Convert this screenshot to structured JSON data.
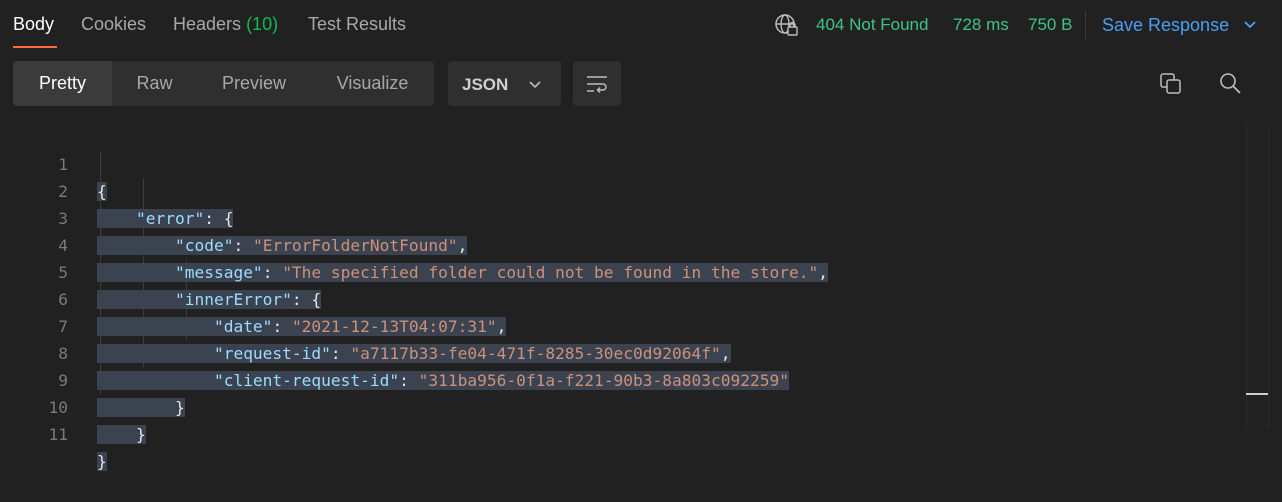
{
  "tabs": {
    "body": "Body",
    "cookies": "Cookies",
    "headers": "Headers",
    "headers_count": "(10)",
    "test_results": "Test Results"
  },
  "response": {
    "status": "404 Not Found",
    "time": "728 ms",
    "size": "750 B",
    "save_label": "Save Response"
  },
  "view": {
    "pretty": "Pretty",
    "raw": "Raw",
    "preview": "Preview",
    "visualize": "Visualize",
    "format": "JSON"
  },
  "icons": [
    "globe-lock-icon",
    "chevron-down-icon",
    "wrap-lines-icon",
    "copy-icon",
    "search-icon"
  ],
  "colors": {
    "accent": "#ff6c37",
    "status": "#3ec487",
    "link": "#4a9ff5",
    "key": "#9cdcfe",
    "string": "#ce9178"
  },
  "code": {
    "line_numbers": [
      "1",
      "2",
      "3",
      "4",
      "5",
      "6",
      "7",
      "8",
      "9",
      "10",
      "11"
    ],
    "open_brace": "{",
    "error_key": "\"error\"",
    "colon_brace": ": {",
    "code_key": "\"code\"",
    "code_val": "\"ErrorFolderNotFound\"",
    "message_key": "\"message\"",
    "message_val": "\"The specified folder could not be found in the store.\"",
    "inner_key": "\"innerError\"",
    "date_key": "\"date\"",
    "date_val": "\"2021-12-13T04:07:31\"",
    "reqid_key": "\"request-id\"",
    "reqid_val": "\"a7117b33-fe04-471f-8285-30ec0d92064f\"",
    "clientid_key": "\"client-request-id\"",
    "clientid_val": "\"311ba956-0f1a-f221-90b3-8a803c092259\"",
    "close_brace": "}",
    "colon": ": ",
    "comma": ","
  }
}
